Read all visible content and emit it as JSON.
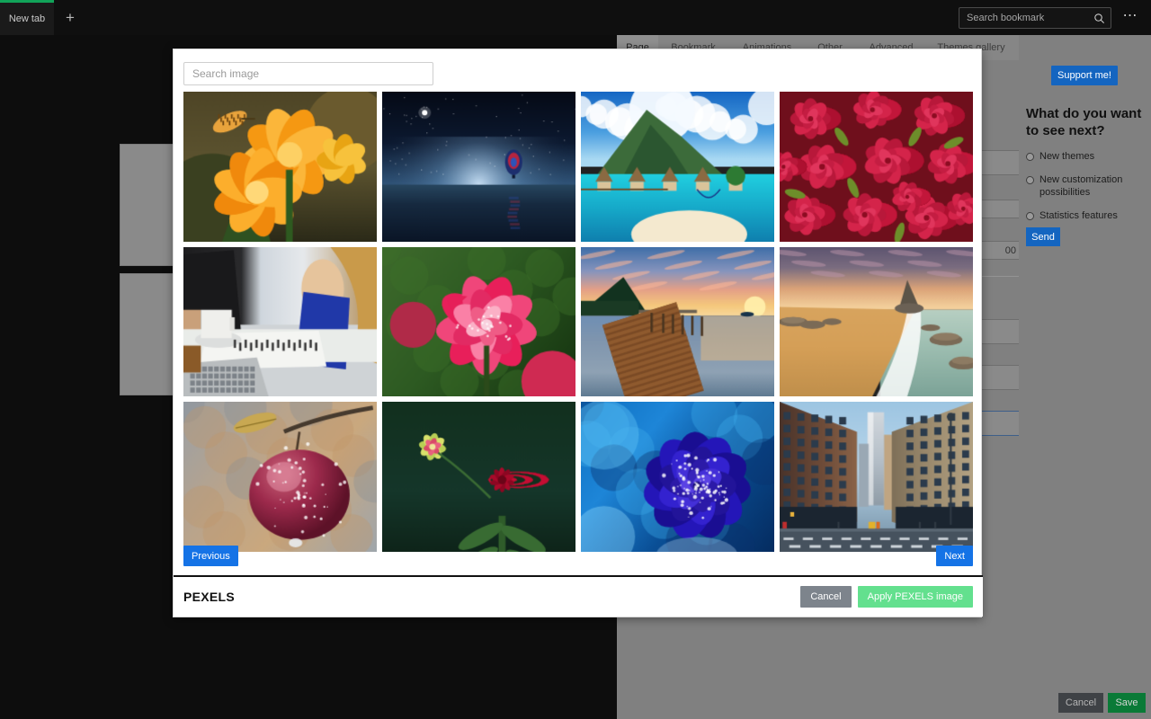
{
  "browser": {
    "tab_label": "New tab",
    "new_tab_icon": "plus-icon",
    "search_placeholder": "Search bookmark",
    "search_icon": "search-icon",
    "menu_icon": "more-options-icon",
    "accent_color": "#11a359"
  },
  "settings": {
    "tabs": [
      {
        "label": "Page",
        "active": true
      },
      {
        "label": "Bookmark",
        "active": false
      },
      {
        "label": "Animations",
        "active": false
      },
      {
        "label": "Other",
        "active": false
      },
      {
        "label": "Advanced",
        "active": false
      },
      {
        "label": "Themes gallery",
        "active": false
      }
    ],
    "spinner_value": "00",
    "cancel_label": "Cancel",
    "save_label": "Save",
    "save_color": "#0a7a37"
  },
  "rail": {
    "support_label": "Support me!",
    "support_color": "#1465c0",
    "heading": "What do you want to see next?",
    "options": [
      {
        "label": "New themes",
        "selected": false
      },
      {
        "label": "New customization possibilities",
        "selected": false
      },
      {
        "label": "Statistics features",
        "selected": false
      }
    ],
    "send_label": "Send"
  },
  "modal": {
    "search_placeholder": "Search image",
    "previous_label": "Previous",
    "next_label": "Next",
    "brand": "PEXELS",
    "cancel_label": "Cancel",
    "apply_label": "Apply PEXELS image",
    "apply_color": "#63e08e",
    "cancel_color": "#7d848c",
    "pager_color": "#1573e6",
    "images": [
      {
        "id": 1,
        "alt": "Orange flowers with butterfly",
        "art": "orange-flowers"
      },
      {
        "id": 2,
        "alt": "Hot air balloon over night water",
        "art": "balloon-night"
      },
      {
        "id": 3,
        "alt": "Tropical island resort lagoon",
        "art": "tropical-island"
      },
      {
        "id": 4,
        "alt": "Bouquet of red roses",
        "art": "red-roses"
      },
      {
        "id": 5,
        "alt": "People working at a desk with laptop",
        "art": "desk-work"
      },
      {
        "id": 6,
        "alt": "Pink rose close-up with dew",
        "art": "pink-rose"
      },
      {
        "id": 7,
        "alt": "Wooden pier at sunset over lake",
        "art": "pier-sunset"
      },
      {
        "id": 8,
        "alt": "Sandy beach with rocks at sunset",
        "art": "beach-rocks"
      },
      {
        "id": 9,
        "alt": "Red apple with water droplets",
        "art": "wet-apple"
      },
      {
        "id": 10,
        "alt": "Red dahlia on dark green background",
        "art": "red-dahlia"
      },
      {
        "id": 11,
        "alt": "Blue rose with water droplets",
        "art": "blue-rose"
      },
      {
        "id": 12,
        "alt": "City street with skyscrapers",
        "art": "city-street"
      }
    ]
  }
}
